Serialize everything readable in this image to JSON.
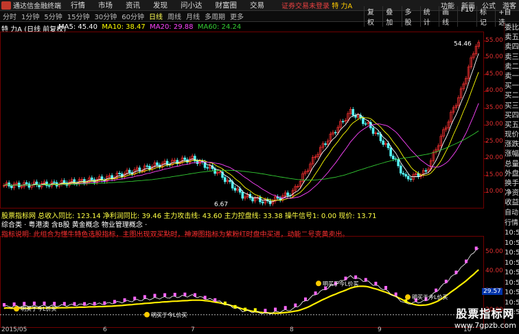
{
  "titlebar": {
    "app_name": "通达信金融终端",
    "menu": [
      "行情",
      "市场",
      "资讯",
      "发现",
      "问小达",
      "财富圈",
      "交易"
    ],
    "warning": "证券交易未登录",
    "stock": "特 力A",
    "right": [
      "功能",
      "新画",
      "公式",
      "游客"
    ]
  },
  "toolbar": {
    "periods": [
      "分时",
      "1分钟",
      "5分钟",
      "15分钟",
      "30分钟",
      "60分钟",
      "日线",
      "周线",
      "月线",
      "多周期",
      "更多"
    ],
    "active_period": "日线",
    "tools": [
      "复权",
      "叠加",
      "多股",
      "统计",
      "画线",
      "F10",
      "标记",
      "+自选"
    ]
  },
  "main_chart": {
    "stock_title": "特 力A (日线 前复权)",
    "ma": [
      {
        "label": "MA5: 45.40",
        "color": "#ffffff"
      },
      {
        "label": "MA10: 38.47",
        "color": "#ffff00"
      },
      {
        "label": "MA20: 29.88",
        "color": "#ff44ff"
      },
      {
        "label": "MA60: 24.24",
        "color": "#33cc33"
      }
    ],
    "y_ticks": [
      "55.00",
      "50.00",
      "45.00",
      "40.00",
      "35.00",
      "30.00",
      "25.00",
      "20.00",
      "15.00",
      "10.00"
    ],
    "high_label": "54.46",
    "low_label": "6.67"
  },
  "side_panel": [
    "委比",
    "卖五",
    "卖四",
    "卖三",
    "卖二",
    "卖一",
    "买一",
    "买二",
    "买三",
    "买四",
    "买五",
    "现价",
    "涨跌",
    "涨幅",
    "总量",
    "外盘",
    "换手",
    "净资",
    "收益"
  ],
  "side_panel2": [
    "自动",
    "行情",
    "10:5",
    "10:5",
    "10:5",
    "10:5",
    "10:5",
    "10:5",
    "10:5",
    "10:5",
    "10:5"
  ],
  "sub_chart": {
    "line1": "股票指标网  总收入同比: 123.14  净利润同比: 39.46  主力攻击线: 43.60  主力控盘线: 33.38  操牛信号1: 0.00  现价: 13.71",
    "line2": "综合类 · 粤港澳 含B股 黄金概念 物业管理概念 ·",
    "line3": "指标说明: 此组合为懂牛特色选股指标，主图出现双买點时，神源图指标为紫粉红时盘中买进，动能二号变黄卖出。",
    "y_ticks": [
      "50.00",
      "40.00",
      "30.00",
      "20.00"
    ],
    "price_tag": "29.57",
    "signal_label": "明买于今L价买"
  },
  "dates": [
    "2015/05",
    "6",
    "7",
    "8",
    "9",
    "10"
  ],
  "watermark": {
    "line1": "股票指标网",
    "line2": "www.7gpzb.com"
  },
  "chart_data": {
    "type": "line",
    "title": "特 力A (日线 前复权)",
    "x": [
      "2015/05",
      "6",
      "7",
      "8",
      "9",
      "10"
    ],
    "series": [
      {
        "name": "MA5",
        "values": [
          12,
          14,
          20,
          8,
          33,
          16,
          45
        ]
      },
      {
        "name": "MA10",
        "values": [
          12,
          13,
          19,
          10,
          30,
          17,
          38
        ]
      },
      {
        "name": "MA20",
        "values": [
          12,
          12,
          18,
          13,
          26,
          19,
          30
        ]
      },
      {
        "name": "MA60",
        "values": [
          12,
          12,
          15,
          14,
          18,
          18,
          24
        ]
      }
    ],
    "ylim": [
      6,
      57
    ]
  }
}
